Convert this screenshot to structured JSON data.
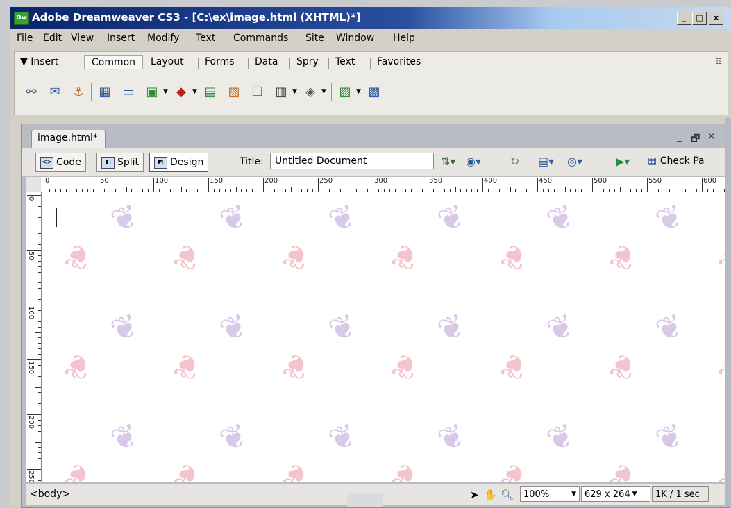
{
  "window": {
    "app_badge": "Dw",
    "title": "Adobe Dreamweaver CS3 - [C:\\ex\\image.html (XHTML)*]",
    "controls": [
      "_",
      "□",
      "x"
    ]
  },
  "menu": [
    "File",
    "Edit",
    "View",
    "Insert",
    "Modify",
    "Text",
    "Commands",
    "Site",
    "Window",
    "Help"
  ],
  "insert_bar": {
    "title": "▼ Insert",
    "tabs": [
      "Common",
      "Layout",
      "Forms",
      "Data",
      "Spry",
      "Text",
      "Favorites"
    ],
    "active_tab": "Common",
    "tool_icons": [
      "hyperlink-icon",
      "email-link-icon",
      "named-anchor-icon",
      "table-icon",
      "div-icon",
      "image-icon",
      "media-icon",
      "date-icon",
      "server-include-icon",
      "comment-icon",
      "head-icon",
      "script-icon",
      "templates-icon",
      "tag-chooser-icon"
    ]
  },
  "document": {
    "tab_label": "image.html*",
    "window_controls": [
      "_",
      "🗗",
      "✕"
    ],
    "view_buttons": {
      "code": "Code",
      "split": "Split",
      "design": "Design"
    },
    "active_view": "Design",
    "title_label": "Title:",
    "title_value": "Untitled Document",
    "check_page": "Check Pa",
    "hruler_labels": [
      "0",
      "50",
      "100",
      "150",
      "200",
      "250",
      "300",
      "350",
      "400",
      "450",
      "500",
      "550",
      "600"
    ],
    "vruler_labels": [
      "0",
      "50",
      "100",
      "150",
      "200",
      "250"
    ]
  },
  "status": {
    "tag_selector": "<body>",
    "zoom": "100%",
    "window_size": "629 x 264",
    "download": "1K / 1 sec"
  },
  "colors": {
    "title_bar_start": "#0a246a",
    "title_bar_end": "#a6caf0",
    "chrome": "#d4d0c8",
    "leaf_pink": "#f3c4cc",
    "leaf_purple": "#d8c9e8"
  }
}
